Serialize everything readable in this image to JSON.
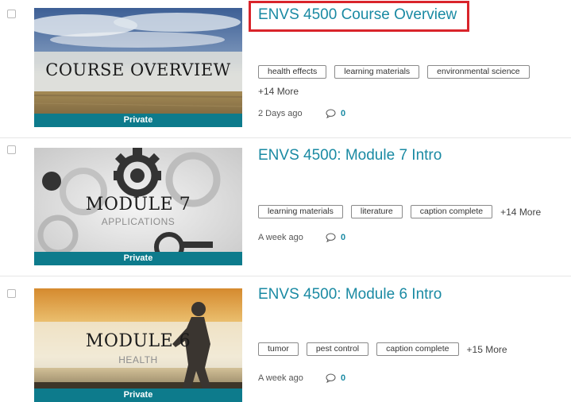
{
  "entries": [
    {
      "title": "ENVS 4500 Course Overview",
      "thumbnail": {
        "title": "COURSE OVERVIEW",
        "subtitle": "",
        "badge": "Private",
        "theme": "clouds-field"
      },
      "tags": [
        "health effects",
        "learning materials",
        "environmental science"
      ],
      "more": "+14 More",
      "time": "2 Days ago",
      "comments": "0",
      "highlighted": true
    },
    {
      "title": "ENVS 4500: Module 7 Intro",
      "thumbnail": {
        "title": "MODULE 7",
        "subtitle": "APPLICATIONS",
        "badge": "Private",
        "theme": "gears"
      },
      "tags": [
        "learning materials",
        "literature",
        "caption complete"
      ],
      "more": "+14 More",
      "time": "A week ago",
      "comments": "0",
      "highlighted": false
    },
    {
      "title": "ENVS 4500: Module 6 Intro",
      "thumbnail": {
        "title": "MODULE 6",
        "subtitle": "HEALTH",
        "badge": "Private",
        "theme": "runner-sunset"
      },
      "tags": [
        "tumor",
        "pest control",
        "caption complete"
      ],
      "more": "+15 More",
      "time": "A week ago",
      "comments": "0",
      "highlighted": false
    }
  ],
  "colors": {
    "link": "#1a8aa3",
    "badge": "#0d7b8c",
    "highlight": "#d9242b"
  },
  "icons": {
    "comment": "speech-bubble-icon"
  }
}
